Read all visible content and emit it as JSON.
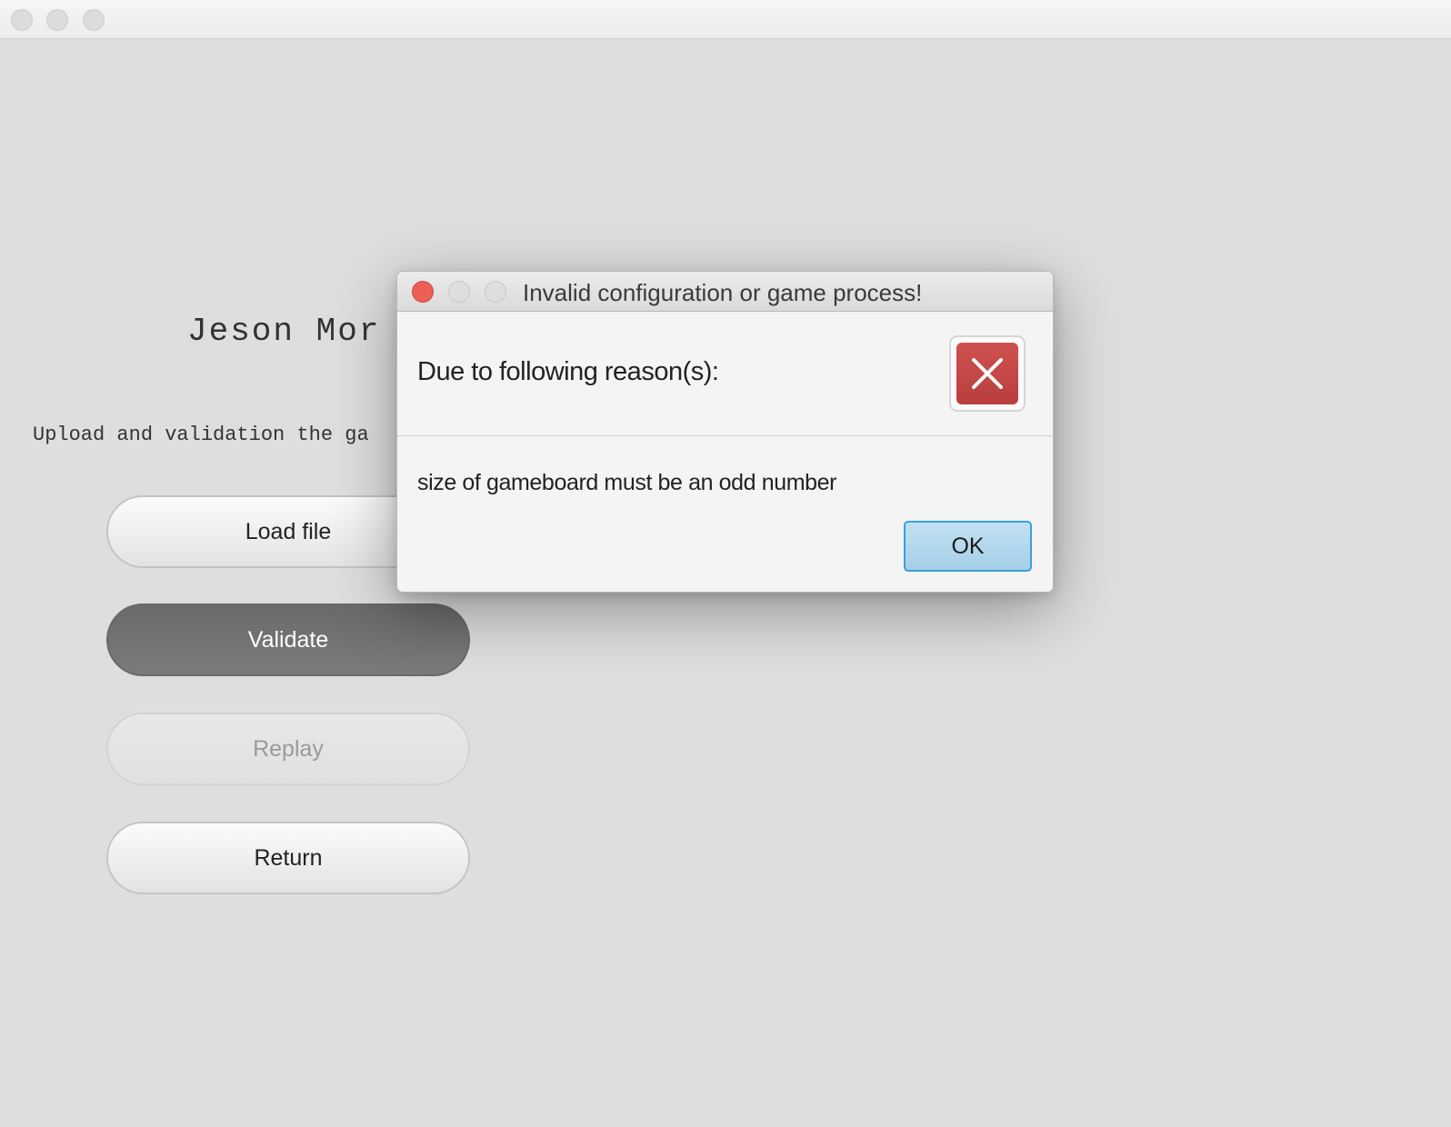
{
  "main": {
    "title": "Jeson Mor",
    "subtitle": "Upload and validation the ga",
    "buttons": {
      "load": "Load file",
      "validate": "Validate",
      "replay": "Replay",
      "return": "Return"
    }
  },
  "dialog": {
    "title": "Invalid configuration or game process!",
    "header": "Due to following reason(s):",
    "message": "size of gameboard must be an odd number",
    "ok_label": "OK"
  },
  "icons": {
    "dialog_icon": "error-x-icon"
  },
  "colors": {
    "close_red": "#ec5f56",
    "error_red": "#c44847",
    "ok_blue": "#3aa1d6",
    "active_button": "#717171"
  }
}
